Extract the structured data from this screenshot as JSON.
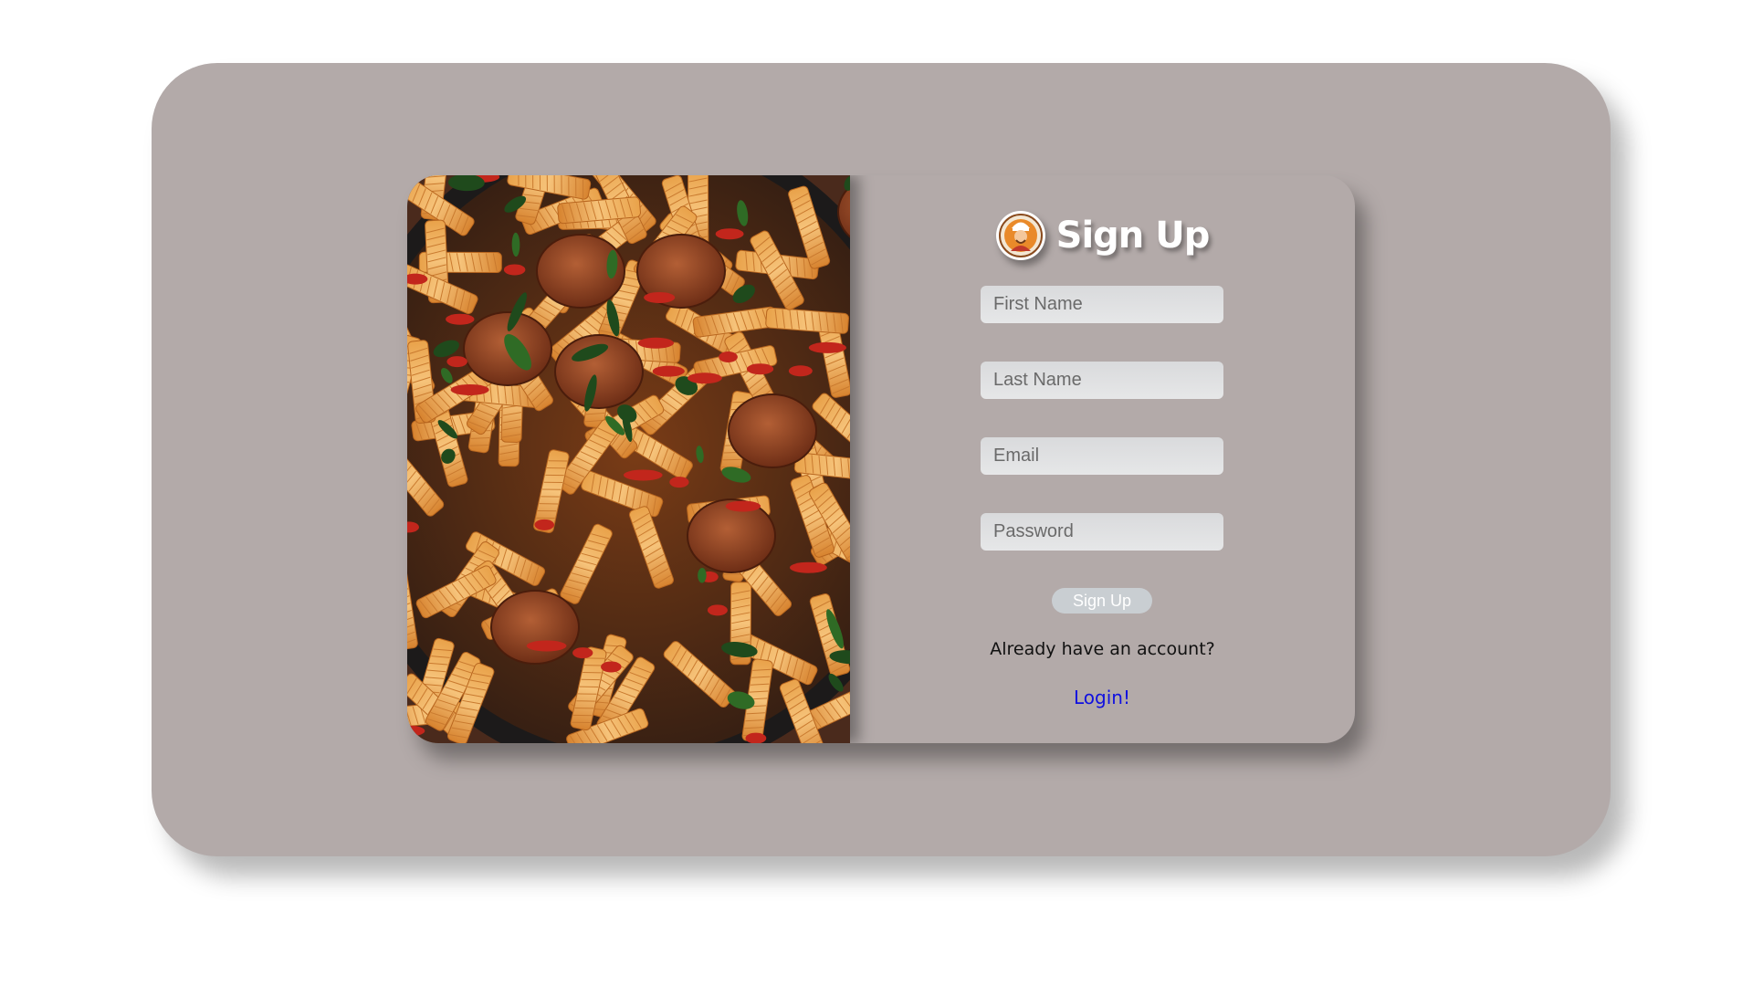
{
  "colors": {
    "outer_panel": "#b3aaa9",
    "input_background": "#e0e1e2",
    "button_background": "#c9ced2",
    "link": "#1010e0",
    "title": "#ffffff"
  },
  "hero_image": {
    "subject": "penne pasta with sausage slices, peppers and spinach in a skillet"
  },
  "header": {
    "logo_icon": "chef-avatar-icon",
    "title": "Sign Up"
  },
  "form": {
    "first_name": {
      "placeholder": "First Name",
      "value": ""
    },
    "last_name": {
      "placeholder": "Last Name",
      "value": ""
    },
    "email": {
      "placeholder": "Email",
      "value": ""
    },
    "password": {
      "placeholder": "Password",
      "value": ""
    },
    "submit_label": "Sign Up"
  },
  "footer": {
    "question": "Already have an account?",
    "login_link": "Login!"
  }
}
